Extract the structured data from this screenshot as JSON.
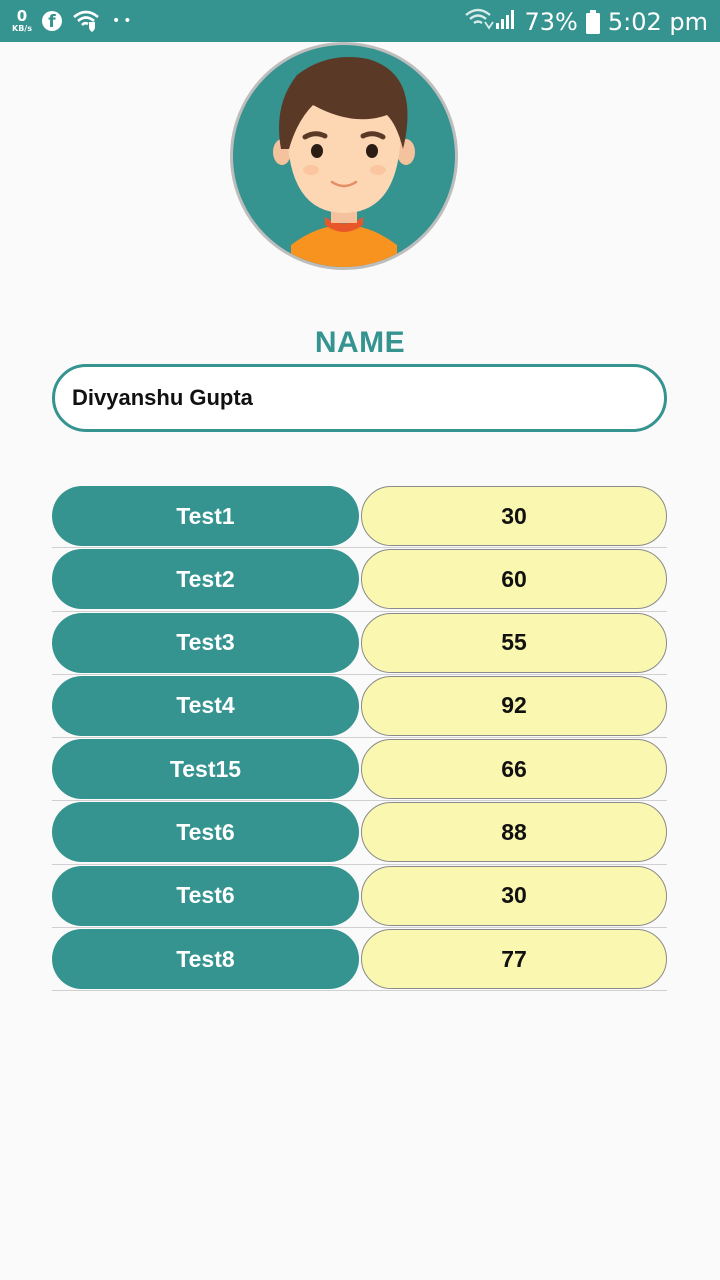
{
  "status_bar": {
    "net_speed_value": "0",
    "net_speed_unit": "KB/s",
    "battery": "73%",
    "time": "5:02 pm"
  },
  "profile": {
    "name_label": "NAME",
    "name_value": "Divyanshu Gupta"
  },
  "scores": [
    {
      "test": "Test1",
      "score": "30"
    },
    {
      "test": "Test2",
      "score": "60"
    },
    {
      "test": "Test3",
      "score": "55"
    },
    {
      "test": "Test4",
      "score": "92"
    },
    {
      "test": "Test15",
      "score": "66"
    },
    {
      "test": "Test6",
      "score": "88"
    },
    {
      "test": "Test6",
      "score": "30"
    },
    {
      "test": "Test8",
      "score": "77"
    }
  ],
  "colors": {
    "teal": "#359390",
    "score_bg": "#faf8b0"
  }
}
